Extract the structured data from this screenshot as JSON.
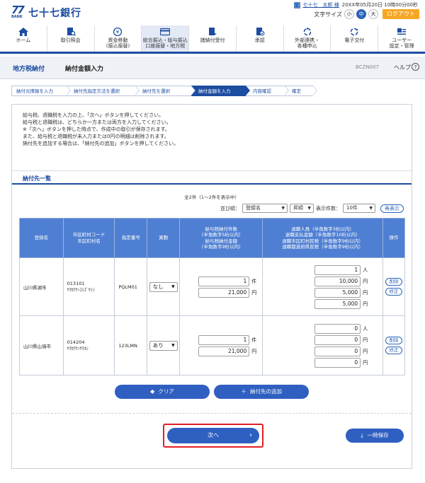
{
  "brand": {
    "logo_mark": "77",
    "logo_bank": "BANK",
    "name": "七十七銀行"
  },
  "user": {
    "icon": "user-icon",
    "name": "七十七　太郎 様",
    "last_login": "20XX年05月20日 10時00分00秒"
  },
  "font_size": {
    "label": "文字サイズ",
    "small": "小",
    "medium": "中",
    "large": "大",
    "selected": "中"
  },
  "logout": "ログアウト",
  "nav": [
    {
      "label": "ホーム",
      "icon": "home-icon"
    },
    {
      "label": "取引照会",
      "icon": "search-document-icon"
    },
    {
      "label": "資金移動\n(振込振替)",
      "icon": "money-transfer-icon"
    },
    {
      "label": "総合振込・給与振込\n口座振替・地方税",
      "icon": "card-icon",
      "active": true
    },
    {
      "label": "諸納付受付",
      "icon": "payment-icon"
    },
    {
      "label": "承認",
      "icon": "approval-icon"
    },
    {
      "label": "外部連携・\n各種申込",
      "icon": "link-icon"
    },
    {
      "label": "電子交付",
      "icon": "e-delivery-icon"
    },
    {
      "label": "ユーザー\n設定・管理",
      "icon": "user-settings-icon"
    }
  ],
  "title": {
    "category": "地方税納付",
    "page": "納付金額入力",
    "screen_id": "BCZN007",
    "help": "ヘルプ"
  },
  "steps": [
    "納付元情報を入力",
    "納付先指定方法を選択",
    "納付先を選択",
    "納付金額を入力",
    "内容確認",
    "確定"
  ],
  "current_step": 3,
  "instructions": [
    "給与税、退職税を入力の上、「次へ」ボタンを押してください。",
    "給与税と退職税は、どちらか一方または両方を入力してください。",
    "※「次へ」ボタンを押した時点で、作成中の取引が保存されます。",
    "また、給与税と退職税が未入力または0円の明細は削除されます。",
    "納付先を追加する場合は、「納付先の追加」ボタンを押してください。"
  ],
  "section_title": "納付先一覧",
  "record_count": "全2件（1～2件を表示中）",
  "sort": {
    "label": "並び順：",
    "field": "登録名",
    "order": "昇順",
    "page_size_label": "表示件数：",
    "page_size": "10件",
    "reshow": "再表示"
  },
  "table": {
    "headers": {
      "name": "登録名",
      "code": "市区町村コード\n市区町村名",
      "designation": "指定番号",
      "change": "異動",
      "salary": "給与税納付件数\n（半角数字5桁以内）\n給与税納付金額\n（半角数字9桁以内）",
      "retire": "退職人員（半角数字3桁以内）\n退職支払金額（半角数字10桁以内）\n退職市区町村民税（半角数字9桁以内）\n退職都道府県民税（半角数字9桁以内）",
      "ops": "操作"
    },
    "rows": [
      {
        "name": "山川県湖市",
        "code": "013101",
        "code_kana": "ﾔﾏｶﾜｹﾝｺﾐｽﾞｳﾐｼ",
        "designation": "PQLM01",
        "change": "なし",
        "salary_count": "1",
        "salary_amount": "21,000",
        "retire_people": "1",
        "retire_payment": "10,000",
        "retire_city": "5,000",
        "retire_pref": "5,000"
      },
      {
        "name": "山川県山嶺市",
        "code": "014204",
        "code_kana": "ﾔﾏｶﾜｹﾝﾔﾏﾈｼ",
        "designation": "123LMN",
        "change": "あり",
        "salary_count": "1",
        "salary_amount": "21,000",
        "retire_people": "0",
        "retire_payment": "0",
        "retire_city": "0",
        "retire_pref": "0"
      }
    ],
    "units": {
      "count": "件",
      "people": "人",
      "yen": "円"
    },
    "delete": "削除",
    "edit": "修正"
  },
  "buttons": {
    "clear": "クリア",
    "add_payee": "納付先の追加",
    "next": "次へ",
    "save_temp": "一時保存"
  },
  "colors": {
    "brand_blue": "#1d4da1",
    "accent_orange": "#f6a623",
    "table_header": "#4f7fd2",
    "highlight_red": "#e41e26"
  }
}
